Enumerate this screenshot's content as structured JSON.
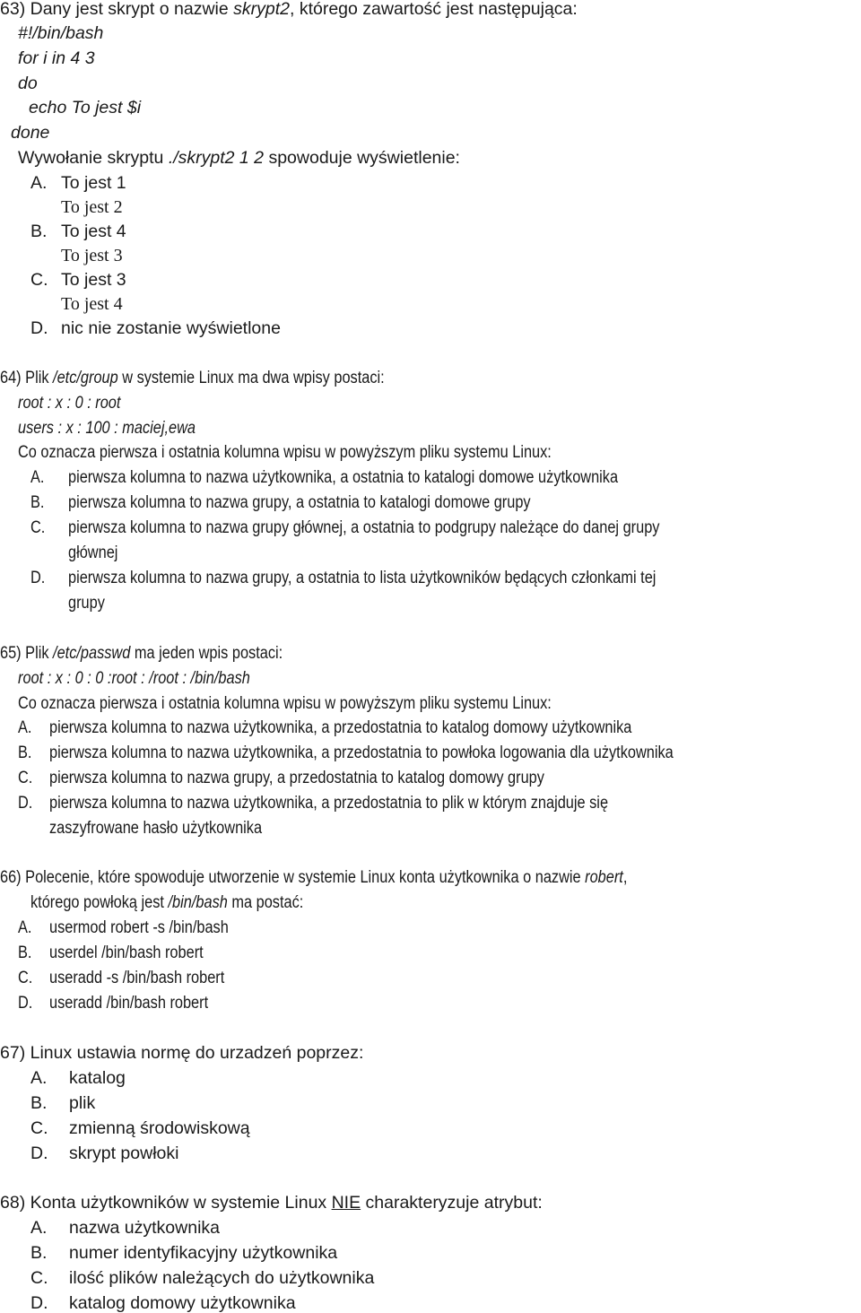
{
  "q63": {
    "number": "63)",
    "intro_pre": "Dany jest skrypt o nazwie ",
    "intro_script": "skrypt2",
    "intro_post": ", którego zawartość jest następująca:",
    "code": [
      "#!/bin/bash",
      "for i in  4  3",
      "do",
      "echo To jest $i",
      "done"
    ],
    "call_pre": "Wywołanie skryptu ",
    "call_cmd": "./skrypt2 1 2",
    "call_post": " spowoduje wyświetlenie:",
    "options": [
      {
        "label": "A.",
        "line1": "To jest 1",
        "line2": "To jest 2"
      },
      {
        "label": "B.",
        "line1": "To jest 4",
        "line2": "To jest 3"
      },
      {
        "label": "C.",
        "line1": "To jest 3",
        "line2": "To jest 4"
      },
      {
        "label": "D.",
        "line1": "nic nie zostanie wyświetlone"
      }
    ]
  },
  "q64": {
    "number": "64)",
    "intro_pre": "Plik ",
    "intro_file": "/etc/group",
    "intro_post": " w systemie Linux ma dwa wpisy postaci:",
    "entries": [
      "root :  x : 0 : root",
      "users : x : 100 : maciej,ewa"
    ],
    "question": "Co oznacza pierwsza i ostatnia kolumna wpisu w powyższym pliku systemu Linux:",
    "options": [
      {
        "label": "A.",
        "text": "pierwsza kolumna to nazwa użytkownika, a ostatnia to katalogi domowe użytkownika"
      },
      {
        "label": "B.",
        "text": "pierwsza kolumna to nazwa grupy, a ostatnia to katalogi domowe grupy"
      },
      {
        "label": "C.",
        "text": "pierwsza kolumna to nazwa grupy głównej, a ostatnia to podgrupy należące do danej grupy",
        "cont": "głównej"
      },
      {
        "label": "D.",
        "text": "pierwsza kolumna to nazwa grupy, a ostatnia to lista użytkowników będących członkami tej",
        "cont": "grupy"
      }
    ]
  },
  "q65": {
    "number": "65)",
    "intro_pre": "Plik ",
    "intro_file": "/etc/passwd",
    "intro_post": " ma jeden wpis postaci:",
    "entry": "root : x : 0 : 0 :root : /root : /bin/bash",
    "question": "Co oznacza pierwsza i ostatnia kolumna wpisu w powyższym pliku systemu Linux:",
    "options": [
      {
        "label": "A.",
        "text": "pierwsza kolumna to nazwa użytkownika, a przedostatnia to katalog domowy użytkownika"
      },
      {
        "label": "B.",
        "text": "pierwsza kolumna to nazwa użytkownika, a przedostatnia to powłoka logowania dla użytkownika"
      },
      {
        "label": "C.",
        "text": "pierwsza kolumna to nazwa grupy, a przedostatnia to katalog domowy grupy"
      },
      {
        "label": "D.",
        "text": "pierwsza kolumna to nazwa użytkownika, a przedostatnia to plik w którym znajduje się",
        "cont": "zaszyfrowane hasło użytkownika"
      }
    ]
  },
  "q66": {
    "number": "66)",
    "intro_pre": "Polecenie, które spowoduje utworzenie w systemie Linux konta użytkownika o nazwie ",
    "intro_user": "robert",
    "intro_post": ",",
    "intro2_pre": "którego powłoką jest ",
    "intro2_shell": "/bin/bash",
    "intro2_post": " ma postać:",
    "options": [
      {
        "label": "A.",
        "text": "usermod  robert -s /bin/bash"
      },
      {
        "label": "B.",
        "text": "userdel /bin/bash robert"
      },
      {
        "label": "C.",
        "text": "useradd -s /bin/bash robert"
      },
      {
        "label": "D.",
        "text": "useradd /bin/bash robert"
      }
    ]
  },
  "q67": {
    "number": "67)",
    "intro": "Linux ustawia normę do urzadzeń poprzez:",
    "options": [
      {
        "label": "A.",
        "text": "katalog"
      },
      {
        "label": "B.",
        "text": "plik"
      },
      {
        "label": "C.",
        "text": "zmienną środowiskową"
      },
      {
        "label": "D.",
        "text": "skrypt powłoki"
      }
    ]
  },
  "q68": {
    "number": "68)",
    "intro_pre": "Konta użytkowników w systemie Linux ",
    "intro_emph": "NIE",
    "intro_post": " charakteryzuje atrybut:",
    "options": [
      {
        "label": "A.",
        "text": "nazwa użytkownika"
      },
      {
        "label": "B.",
        "text": "numer identyfikacyjny użytkownika"
      },
      {
        "label": "C.",
        "text": "ilość plików należących do użytkownika"
      },
      {
        "label": "D.",
        "text": "katalog domowy użytkownika"
      }
    ]
  }
}
